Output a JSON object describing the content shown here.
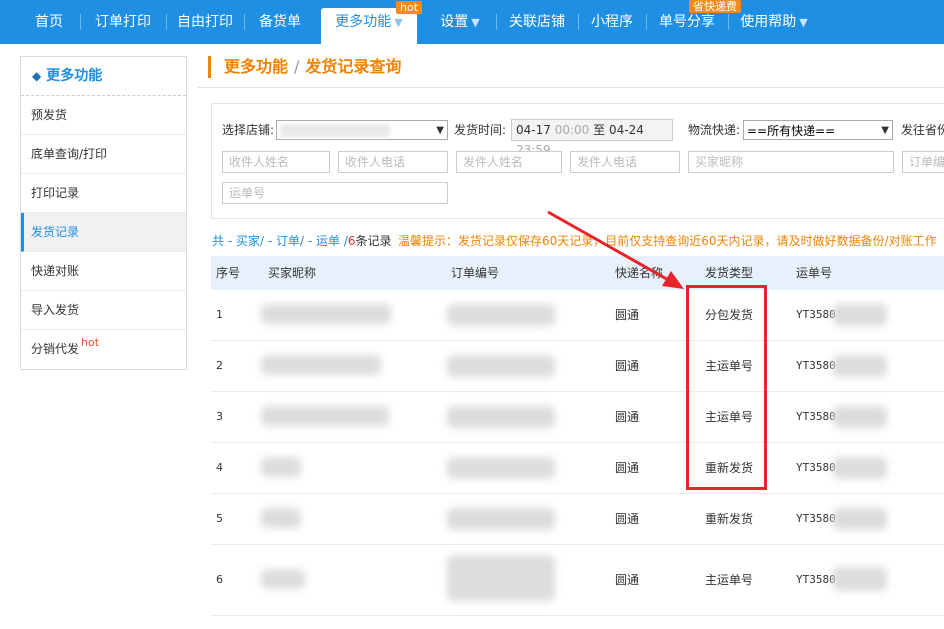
{
  "nav": {
    "items": [
      {
        "label": "首页"
      },
      {
        "label": "订单打印"
      },
      {
        "label": "自由打印"
      },
      {
        "label": "备货单"
      },
      {
        "label": "更多功能",
        "arrow": "▼"
      },
      {
        "label": "设置",
        "arrow": "▼"
      },
      {
        "label": "关联店铺"
      },
      {
        "label": "小程序"
      },
      {
        "label": "单号分享"
      },
      {
        "label": "使用帮助",
        "arrow": "▼"
      }
    ],
    "hot_badge": "hot",
    "save_badge": "省快递费"
  },
  "sidebar": {
    "title": "更多功能",
    "items": [
      {
        "label": "预发货"
      },
      {
        "label": "底单查询/打印"
      },
      {
        "label": "打印记录"
      },
      {
        "label": "发货记录"
      },
      {
        "label": "快递对账"
      },
      {
        "label": "导入发货"
      },
      {
        "label": "分销代发",
        "sup": "hot"
      }
    ]
  },
  "crumb": {
    "parent": "更多功能",
    "sep": "/",
    "current": "发货记录查询"
  },
  "filters": {
    "store_label": "选择店铺:",
    "time_label": "发货时间:",
    "date_from": "04-17",
    "time_from": "00:00",
    "date_to_label": "至",
    "date_to": "04-24",
    "time_to": "23:59",
    "express_label": "物流快递:",
    "express_value": "==所有快递==",
    "dest_label": "发往省份",
    "placeholders": {
      "receiver_name": "收件人姓名",
      "receiver_phone": "收件人电话",
      "sender_name": "发件人姓名",
      "sender_phone": "发件人电话",
      "buyer_nick": "买家昵称",
      "order_no": "订单编",
      "waybill": "运单号"
    }
  },
  "summary": {
    "p1": "共 - ",
    "buyer": "买家",
    "p2": "/ - ",
    "order": "订单",
    "p3": "/ - ",
    "waybill": "运单",
    "p4": " /",
    "count": "6",
    "p5": "条记录"
  },
  "tip": "温馨提示：发货记录仅保存60天记录，目前仅支持查询近60天内记录，请及时做好数据备份/对账工作",
  "table": {
    "headers": [
      "序号",
      "买家昵称",
      "订单编号",
      "快递名称",
      "发货类型",
      "运单号"
    ],
    "rows": [
      {
        "no": "1",
        "express": "圆通",
        "type": "分包发货",
        "waybill": "YT3580"
      },
      {
        "no": "2",
        "express": "圆通",
        "type": "主运单号",
        "waybill": "YT3580"
      },
      {
        "no": "3",
        "express": "圆通",
        "type": "主运单号",
        "waybill": "YT3580"
      },
      {
        "no": "4",
        "express": "圆通",
        "type": "重新发货",
        "waybill": "YT3580"
      },
      {
        "no": "5",
        "express": "圆通",
        "type": "重新发货",
        "waybill": "YT3580"
      },
      {
        "no": "6",
        "express": "圆通",
        "type": "主运单号",
        "waybill": "YT3580"
      }
    ]
  },
  "colors": {
    "nav_bg": "#1e8fe3",
    "accent_orange": "#f08300",
    "annotation_red": "#e8242b"
  }
}
